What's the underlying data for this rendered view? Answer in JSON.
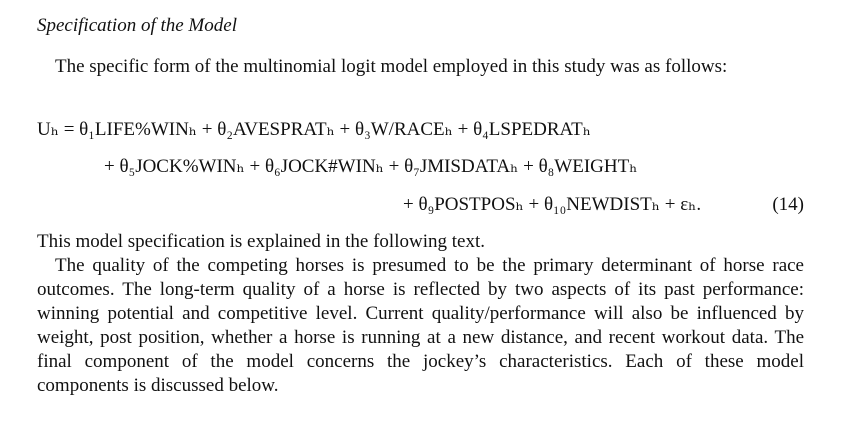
{
  "section": {
    "heading": "Specification of the Model"
  },
  "intro_paragraph": "The specific form of the multinomial logit model employed in this study was as follows:",
  "equation": {
    "line1": "Uₕ = θ₁LIFE%WINₕ + θ₂AVESPRATₕ + θ₃W/RACEₕ + θ₄LSPEDRATₕ",
    "line2": "+ θ₅JOCK%WINₕ + θ₆JOCK#WINₕ + θ₇JMISDATAₕ + θ₈WEIGHTₕ",
    "line3": "+ θ₉POSTPOSₕ + θ₁₀NEWDISTₕ + εₕ.",
    "number": "(14)"
  },
  "explanation_line": "This model specification is explained in the following text.",
  "body_paragraph": "The quality of the competing horses is presumed to be the primary determinant of horse race outcomes. The long-term quality of a horse is reflected by two aspects of its past performance: winning potential and competitive level. Current quality/performance will also be influenced by weight, post position, whether a horse is running at a new distance, and recent workout data. The final component of the model concerns the jockey’s characteristics. Each of these model components is discussed below."
}
